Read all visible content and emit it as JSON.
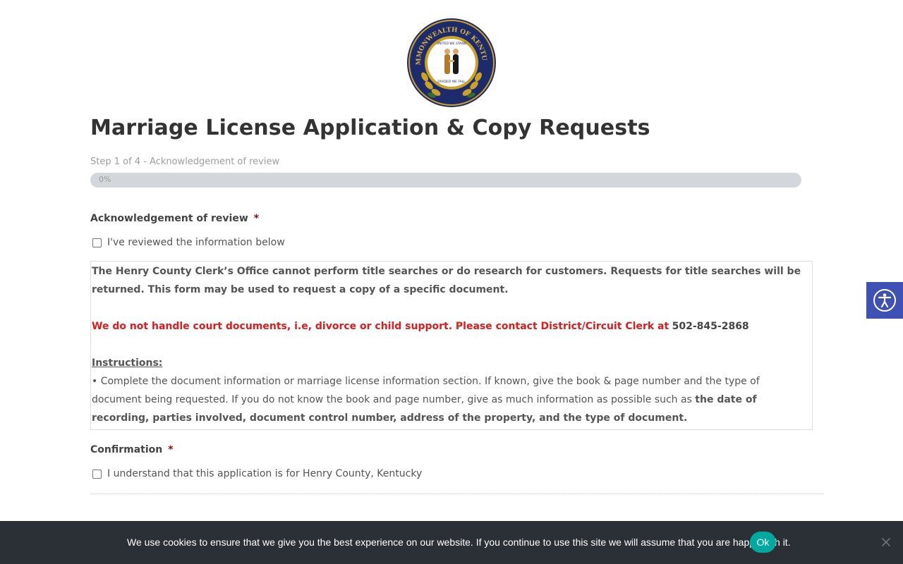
{
  "seal": {
    "outer_text": "COMMONWEALTH OF KENTUCKY",
    "inner_top": "UNITED WE STAND",
    "inner_bottom": "DIVIDED WE FALL"
  },
  "page_title": "Marriage License Application & Copy Requests",
  "progress": {
    "step_label": "Step 1 of 4 - Acknowledgement of review",
    "percent_text": "0%",
    "percent": 0
  },
  "ack": {
    "label": "Acknowledgement of review",
    "required_mark": "*",
    "checkbox_label": "I've reviewed the information below",
    "checked": false
  },
  "info": {
    "para1": "The Henry County Clerk’s Office cannot perform title searches or do research for customers. Requests for title searches will be returned. This form may be used to request a copy of a specific document.",
    "red_note": "We do not handle court documents, i.e, divorce or child support. Please contact District/Circuit Clerk at",
    "phone": "502-845-2868",
    "instructions_heading": "Instructions:",
    "instruction_text": "• Complete the document information or marriage license information section. If known, give the book & page number and the type of document being requested. If you do not know the book and page number, give as much information as possible such as",
    "instruction_bold": "the date of recording, parties involved, document control number, address of the property, and the type of document."
  },
  "confirmation": {
    "label": "Confirmation",
    "required_mark": "*",
    "checkbox_label": "I understand that this application is for Henry County, Kentucky",
    "checked": false
  },
  "cookie": {
    "text": "We use cookies to ensure that we give you the best experience on our website. If you continue to use this site we will assume that you are happy with it.",
    "ok_label": "Ok"
  },
  "icons": {
    "accessibility": "accessibility-icon",
    "close": "close-icon"
  },
  "colors": {
    "accent_red": "#e01b1b",
    "required": "#8b0a0a",
    "a11y_blue": "#3f51b5",
    "ok_teal": "#00a99d",
    "cookie_bg": "#2b2f36"
  }
}
